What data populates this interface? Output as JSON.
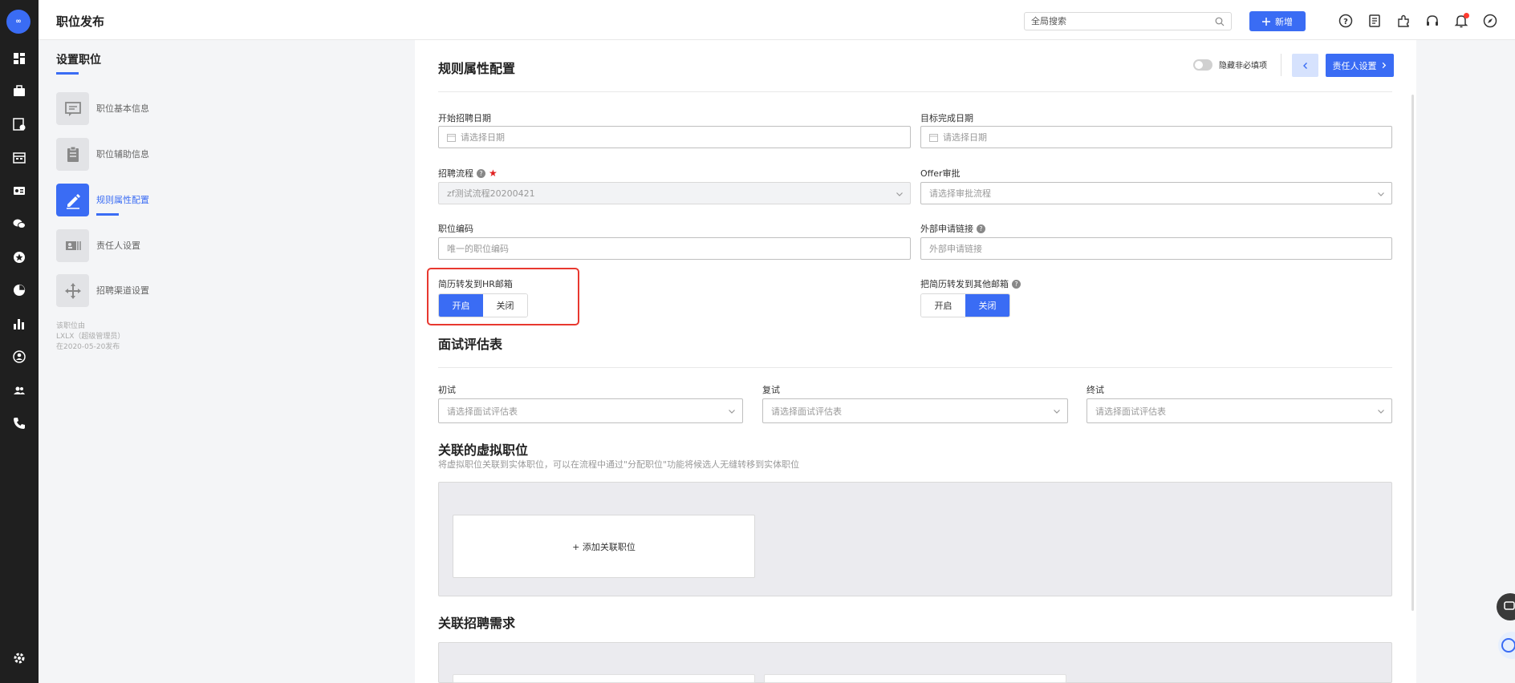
{
  "app": {
    "logo_text": "∞",
    "page_title": "职位发布"
  },
  "header": {
    "search": {
      "placeholder": "全局搜索"
    },
    "new_button": {
      "icon": "plus-icon",
      "label": "新增"
    },
    "icons": [
      "help-circle-icon",
      "document-icon",
      "plugin-icon",
      "headset-icon",
      "bell-icon",
      "compass-icon"
    ]
  },
  "rail": {
    "icons": [
      "dashboard-icon",
      "briefcase-icon",
      "resume-icon",
      "calendar-icon",
      "id-card-icon",
      "wechat-icon",
      "star-badge-icon",
      "pie-chart-icon",
      "bar-chart-icon",
      "user-circle-icon",
      "team-icon",
      "phone-icon",
      "settings-icon"
    ]
  },
  "steps": {
    "title": "设置职位",
    "items": [
      {
        "label": "职位基本信息",
        "icon": "chat-box-icon",
        "active": false
      },
      {
        "label": "职位辅助信息",
        "icon": "clipboard-icon",
        "active": false
      },
      {
        "label": "规则属性配置",
        "icon": "pencil-icon",
        "active": true
      },
      {
        "label": "责任人设置",
        "icon": "contact-card-icon",
        "active": false
      },
      {
        "label": "招聘渠道设置",
        "icon": "move-arrows-icon",
        "active": false
      }
    ],
    "meta": {
      "line1": "该职位由",
      "line2": "LXLX（超级管理员）",
      "line3": "在2020-05-20发布"
    }
  },
  "form": {
    "section_title": "规则属性配置",
    "hide_optional_label": "隐藏非必填项",
    "next_button": "责任人设置",
    "start_date": {
      "label": "开始招聘日期",
      "placeholder": "请选择日期"
    },
    "target_date": {
      "label": "目标完成日期",
      "placeholder": "请选择日期"
    },
    "process": {
      "label": "招聘流程",
      "value": "zf测试流程20200421",
      "required": true
    },
    "offer": {
      "label": "Offer审批",
      "placeholder": "请选择审批流程"
    },
    "code": {
      "label": "职位编码",
      "placeholder": "唯一的职位编码"
    },
    "external_link": {
      "label": "外部申请链接",
      "placeholder": "外部申请链接"
    },
    "forward_hr": {
      "label": "简历转发到HR邮箱",
      "on": "开启",
      "off": "关闭",
      "selected": "开启"
    },
    "forward_other": {
      "label": "把简历转发到其他邮箱",
      "on": "开启",
      "off": "关闭",
      "selected": "关闭"
    }
  },
  "interview": {
    "section_title": "面试评估表",
    "first": {
      "label": "初试",
      "placeholder": "请选择面试评估表"
    },
    "second": {
      "label": "复试",
      "placeholder": "请选择面试评估表"
    },
    "final": {
      "label": "终试",
      "placeholder": "请选择面试评估表"
    }
  },
  "virtual": {
    "section_title": "关联的虚拟职位",
    "note": "将虚拟职位关联到实体职位，可以在流程中通过\"分配职位\"功能将候选人无缝转移到实体职位",
    "add_label": "+ 添加关联职位"
  },
  "demand": {
    "section_title": "关联招聘需求"
  }
}
